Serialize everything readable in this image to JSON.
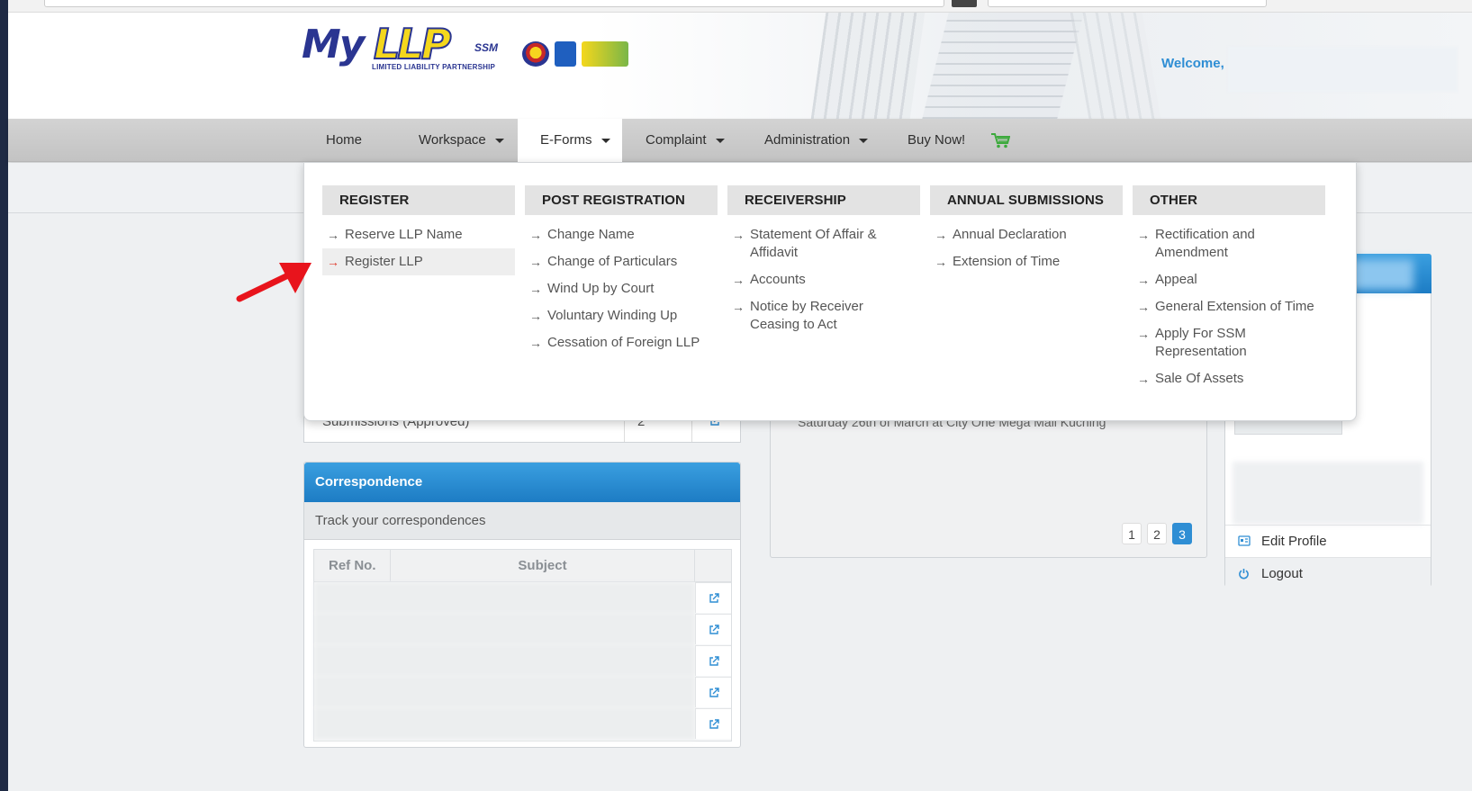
{
  "brand": {
    "logo_my": "My",
    "logo_llp": "LLP",
    "logo_ssm": "SSM",
    "logo_tagline": "LIMITED LIABILITY PARTNERSHIP"
  },
  "header": {
    "welcome": "Welcome,"
  },
  "nav": {
    "items": [
      {
        "label": "Home"
      },
      {
        "label": "Workspace"
      },
      {
        "label": "E-Forms"
      },
      {
        "label": "Complaint"
      },
      {
        "label": "Administration"
      },
      {
        "label": "Buy Now!"
      }
    ],
    "active": "E-Forms"
  },
  "eforms_menu": {
    "columns": [
      {
        "heading": "REGISTER",
        "items": [
          "Reserve LLP Name",
          "Register LLP"
        ]
      },
      {
        "heading": "POST REGISTRATION",
        "items": [
          "Change Name",
          "Change of Particulars",
          "Wind Up by Court",
          "Voluntary Winding Up",
          "Cessation of Foreign LLP"
        ]
      },
      {
        "heading": "RECEIVERSHIP",
        "items": [
          "Statement Of Affair & Affidavit",
          "Accounts",
          "Notice by Receiver Ceasing to Act"
        ]
      },
      {
        "heading": "ANNUAL SUBMISSIONS",
        "items": [
          "Annual Declaration",
          "Extension of Time"
        ]
      },
      {
        "heading": "OTHER",
        "items": [
          "Rectification and Amendment",
          "Appeal",
          "General Extension of Time",
          "Apply For SSM Representation",
          "Sale Of Assets"
        ]
      }
    ],
    "highlighted_item": "Register LLP"
  },
  "submissions": {
    "label": "Submissions (Approved)",
    "count": "2"
  },
  "correspondence": {
    "title": "Correspondence",
    "subtitle": "Track your correspondences",
    "columns": [
      "Ref No.",
      "Subject"
    ]
  },
  "news": {
    "text": "Saturday 26th of March at City One Mega Mall Kuching",
    "pages": [
      "1",
      "2",
      "3"
    ],
    "current_page": "3"
  },
  "profile": {
    "edit_profile": "Edit Profile",
    "logout": "Logout"
  },
  "colors": {
    "accent_blue": "#2f8ed4",
    "nav_gray": "#c8c8c8",
    "annotation_red": "#e8141c"
  }
}
